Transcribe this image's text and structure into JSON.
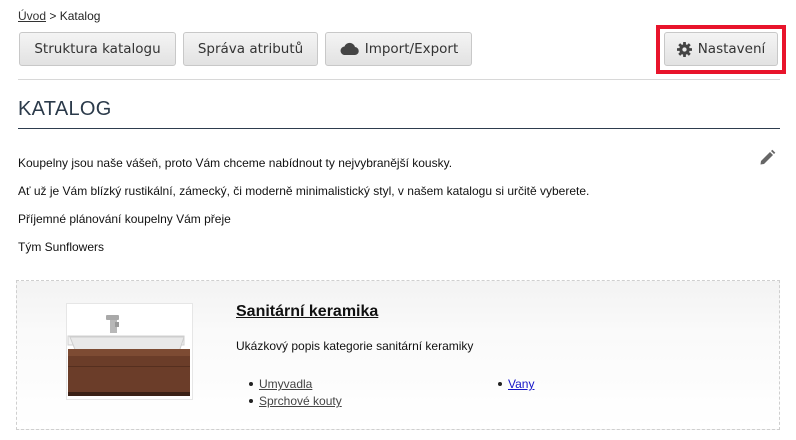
{
  "breadcrumb": {
    "home": "Úvod",
    "separator": ">",
    "current": "Katalog"
  },
  "toolbar": {
    "structure_label": "Struktura katalogu",
    "attributes_label": "Správa atributů",
    "import_export_label": "Import/Export",
    "settings_label": "Nastavení"
  },
  "page": {
    "title": "KATALOG",
    "paragraphs": [
      "Koupelny jsou naše vášeň, proto Vám chceme nabídnout ty nejvybranější kousky.",
      "Ať už je Vám blízký rustikální, zámecký, či moderně minimalistický styl, v našem katalogu si určitě vyberete.",
      "Příjemné plánování koupelny Vám přeje",
      "Tým Sunflowers"
    ]
  },
  "category": {
    "title": "Sanitární keramika",
    "description": "Ukázkový popis kategorie sanitární keramiky",
    "subcategories": [
      "Umyvadla",
      "Sprchové kouty",
      "Vany"
    ]
  },
  "colors": {
    "highlight": "#e8142b",
    "title": "#2b3a4a"
  },
  "icons": {
    "settings": "gear-icon",
    "import_export": "cloud-icon",
    "edit": "pencil-icon"
  }
}
